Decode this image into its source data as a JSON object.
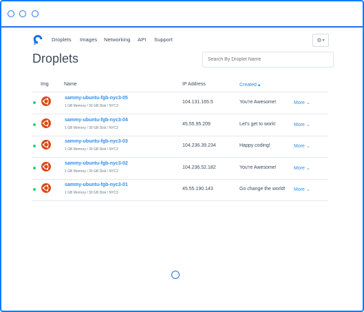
{
  "nav": {
    "items": [
      "Droplets",
      "Images",
      "Networking",
      "API",
      "Support"
    ]
  },
  "page": {
    "title": "Droplets"
  },
  "search": {
    "placeholder": "Search By Droplet Name"
  },
  "table": {
    "headers": {
      "img": "Img",
      "name": "Name",
      "ip": "IP Address",
      "created": "Created ▴"
    },
    "rows": [
      {
        "name": "sammy-ubuntu-fgb-nyc3-05",
        "meta": "1 GB Memory / 30 GB Disk / NYC3",
        "ip": "104.131.165.5",
        "message": "You're Awesome!",
        "more": "More ⌄"
      },
      {
        "name": "sammy-ubuntu-fgb-nyc3-04",
        "meta": "1 GB Memory / 30 GB Disk / NYC3",
        "ip": "45.55.95.209",
        "message": "Let's get to work!",
        "more": "More ⌄"
      },
      {
        "name": "sammy-ubuntu-fgb-nyc3-03",
        "meta": "1 GB Memory / 30 GB Disk / NYC3",
        "ip": "104.236.39.234",
        "message": "Happy coding!",
        "more": "More ⌄"
      },
      {
        "name": "sammy-ubuntu-fgb-nyc3-02",
        "meta": "1 GB Memory / 30 GB Disk / NYC3",
        "ip": "104.236.52.182",
        "message": "You're Awesome!",
        "more": "More ⌄"
      },
      {
        "name": "sammy-ubuntu-fgb-nyc3-01",
        "meta": "1 GB Memory / 30 GB Disk / NYC3",
        "ip": "45.55.190.143",
        "message": "Go change the world!",
        "more": "More ⌄"
      }
    ]
  },
  "colors": {
    "accent": "#1f8ceb",
    "status_active": "#2ecc71",
    "ubuntu": "#dd4814"
  },
  "icons": {
    "logo": "digitalocean-logo-icon",
    "settings": "gear-icon",
    "distro": "ubuntu-icon",
    "loading": "spinner-icon"
  }
}
